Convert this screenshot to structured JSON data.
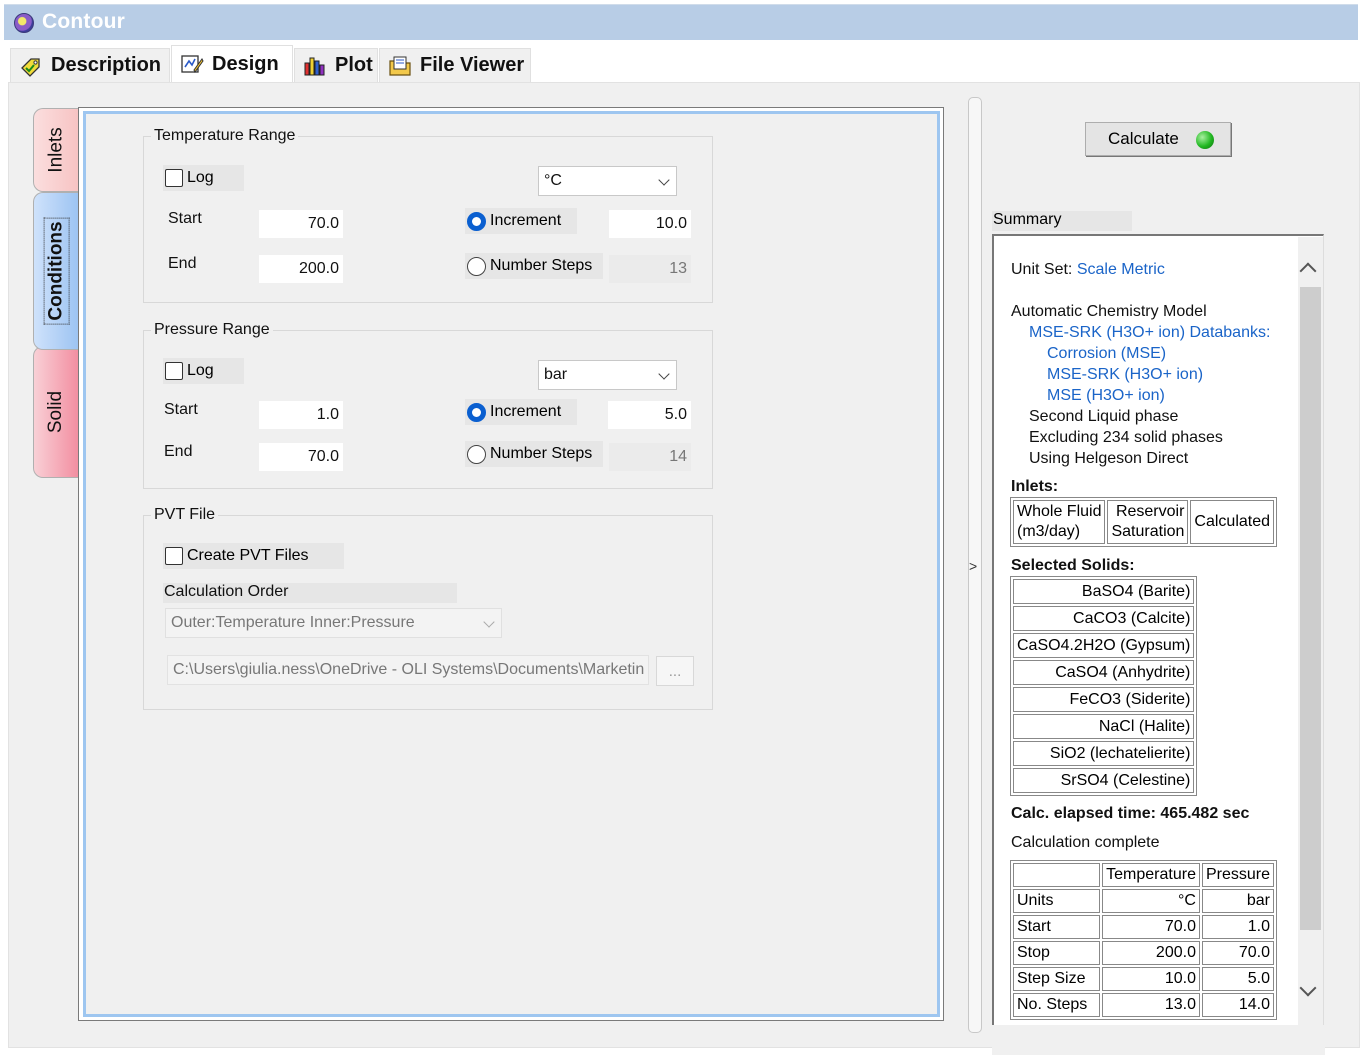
{
  "window": {
    "title": "Contour"
  },
  "top_tabs": [
    {
      "label": "Description",
      "icon": "tag-check-icon"
    },
    {
      "label": "Design",
      "icon": "design-edit-icon"
    },
    {
      "label": "Plot",
      "icon": "bar-chart-icon"
    },
    {
      "label": "File Viewer",
      "icon": "file-folder-icon"
    }
  ],
  "side_tabs": {
    "inlets": "Inlets",
    "conditions": "Conditions",
    "solid": "Solid"
  },
  "temperature": {
    "group_label": "Temperature Range",
    "log_label": "Log",
    "unit": "°C",
    "start_label": "Start",
    "start_value": "70.0",
    "end_label": "End",
    "end_value": "200.0",
    "increment_label": "Increment",
    "increment_value": "10.0",
    "steps_label": "Number Steps",
    "steps_value": "13"
  },
  "pressure": {
    "group_label": "Pressure Range",
    "log_label": "Log",
    "unit": "bar",
    "start_label": "Start",
    "start_value": "1.0",
    "end_label": "End",
    "end_value": "70.0",
    "increment_label": "Increment",
    "increment_value": "5.0",
    "steps_label": "Number Steps",
    "steps_value": "14"
  },
  "pvt": {
    "group_label": "PVT File",
    "create_label": "Create PVT Files",
    "order_label": "Calculation Order",
    "order_value": "Outer:Temperature Inner:Pressure",
    "path_value": "C:\\Users\\giulia.ness\\OneDrive - OLI Systems\\Documents\\Marketin",
    "browse_label": "..."
  },
  "calculate": {
    "label": "Calculate",
    "status_color": "#22b822"
  },
  "summary": {
    "label": "Summary",
    "unit_set_label": "Unit Set:",
    "unit_set_value": "Scale Metric",
    "model_heading": "Automatic Chemistry Model",
    "databank_label": "MSE-SRK (H3O+ ion) Databanks:",
    "databanks": [
      "Corrosion (MSE)",
      "MSE-SRK (H3O+ ion)",
      "MSE (H3O+ ion)"
    ],
    "options": [
      "Second Liquid phase",
      "Excluding 234 solid phases",
      "Using Helgeson Direct"
    ],
    "inlets_heading": "Inlets:",
    "inlets_table": {
      "c1_line1": "Whole Fluid",
      "c1_line2": "(m3/day)",
      "c2_line1": "Reservoir",
      "c2_line2": "Saturation",
      "c3": "Calculated"
    },
    "solids_heading": "Selected Solids:",
    "solids": [
      "BaSO4 (Barite)",
      "CaCO3 (Calcite)",
      "CaSO4.2H2O (Gypsum)",
      "CaSO4 (Anhydrite)",
      "FeCO3 (Siderite)",
      "NaCl (Halite)",
      "SiO2 (lechatelierite)",
      "SrSO4 (Celestine)"
    ],
    "elapsed": "Calc. elapsed time: 465.482 sec",
    "status": "Calculation complete",
    "results": {
      "headers": [
        "",
        "Temperature",
        "Pressure"
      ],
      "rows": [
        [
          "Units",
          "°C",
          "bar"
        ],
        [
          "Start",
          "70.0",
          "1.0"
        ],
        [
          "Stop",
          "200.0",
          "70.0"
        ],
        [
          "Step Size",
          "10.0",
          "5.0"
        ],
        [
          "No. Steps",
          "13.0",
          "14.0"
        ]
      ]
    }
  }
}
